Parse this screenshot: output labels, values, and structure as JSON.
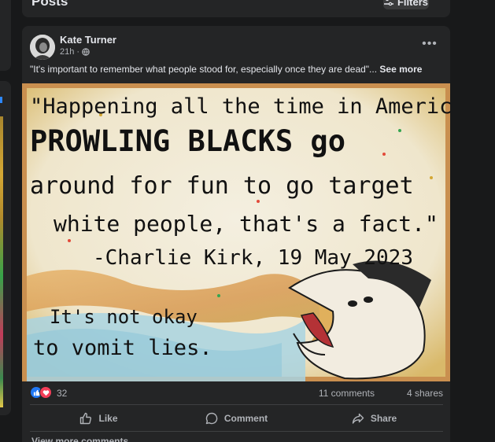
{
  "header": {
    "title": "Posts",
    "filters_label": "Filters"
  },
  "post": {
    "author": "Kate Turner",
    "time": "21h",
    "time_separator": "·",
    "caption_text": "\"It's important to remember what people stood for, especially once they are dead\"...",
    "see_more": "See more",
    "more_icon": "•••",
    "image": {
      "quote_lines": [
        "\"Happening all the time in America,",
        "PROWLING BLACKS go",
        "around for fun to go target",
        "white people, that's a fact.\"",
        "-Charlie Kirk, 19 May 2023"
      ],
      "tagline_lines": [
        "It's not okay",
        "to vomit lies."
      ]
    },
    "reaction_count": "32",
    "comments_count": "11 comments",
    "shares_count": "4 shares",
    "actions": {
      "like": "Like",
      "comment": "Comment",
      "share": "Share"
    },
    "view_more_comments": "View more comments"
  },
  "colors": {
    "background": "#18191a",
    "card": "#242526",
    "text_primary": "#e4e6eb",
    "text_secondary": "#b0b3b8",
    "like_blue": "#2078f4",
    "love_red": "#f33e58"
  }
}
